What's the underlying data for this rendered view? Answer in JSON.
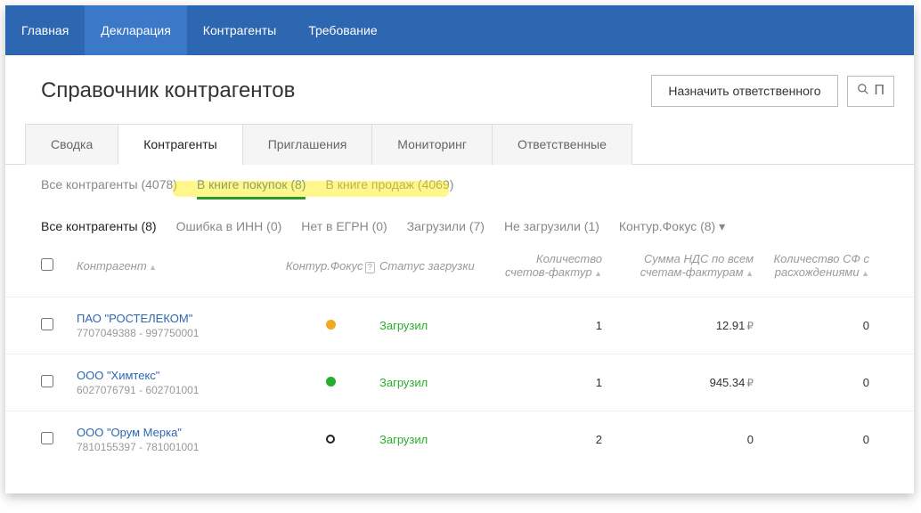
{
  "nav": {
    "items": [
      "Главная",
      "Декларация",
      "Контрагенты",
      "Требование"
    ],
    "active_index": 1
  },
  "header": {
    "title": "Справочник контрагентов",
    "assign_btn": "Назначить ответственного",
    "search_placeholder": "П"
  },
  "tabs": {
    "items": [
      "Сводка",
      "Контрагенты",
      "Приглашения",
      "Мониторинг",
      "Ответственные"
    ],
    "active_index": 1
  },
  "subfilters": {
    "items": [
      {
        "label": "Все контрагенты (4078)"
      },
      {
        "label": "В книге покупок (8)"
      },
      {
        "label": "В книге продаж (4069)"
      }
    ],
    "active_index": 1
  },
  "filters2": {
    "items": [
      {
        "label": "Все контрагенты (8)"
      },
      {
        "label": "Ошибка в ИНН (0)"
      },
      {
        "label": "Нет в ЕГРН (0)"
      },
      {
        "label": "Загрузили (7)"
      },
      {
        "label": "Не загрузили (1)"
      },
      {
        "label": "Контур.Фокус (8) ▾"
      }
    ],
    "active_index": 0
  },
  "columns": {
    "name": "Контрагент",
    "focus": "Контур.Фокус",
    "status": "Статус загрузки",
    "count": "Количество счетов-фактур",
    "sum": "Сумма НДС по всем счетам-фактурам",
    "disc": "Количество СФ с расхождениями"
  },
  "rows": [
    {
      "name": "ПАО \"РОСТЕЛЕКОМ\"",
      "sub": "7707049388 - 997750001",
      "dot": "orange",
      "status": "Загрузил",
      "count": "1",
      "sum": "12.91",
      "disc": "0"
    },
    {
      "name": "ООО \"Химтекс\"",
      "sub": "6027076791 - 602701001",
      "dot": "green",
      "status": "Загрузил",
      "count": "1",
      "sum": "945.34",
      "disc": "0"
    },
    {
      "name": "ООО \"Орум Мерка\"",
      "sub": "7810155397 - 781001001",
      "dot": "outline",
      "status": "Загрузил",
      "count": "2",
      "sum": "0",
      "disc": "0"
    }
  ]
}
